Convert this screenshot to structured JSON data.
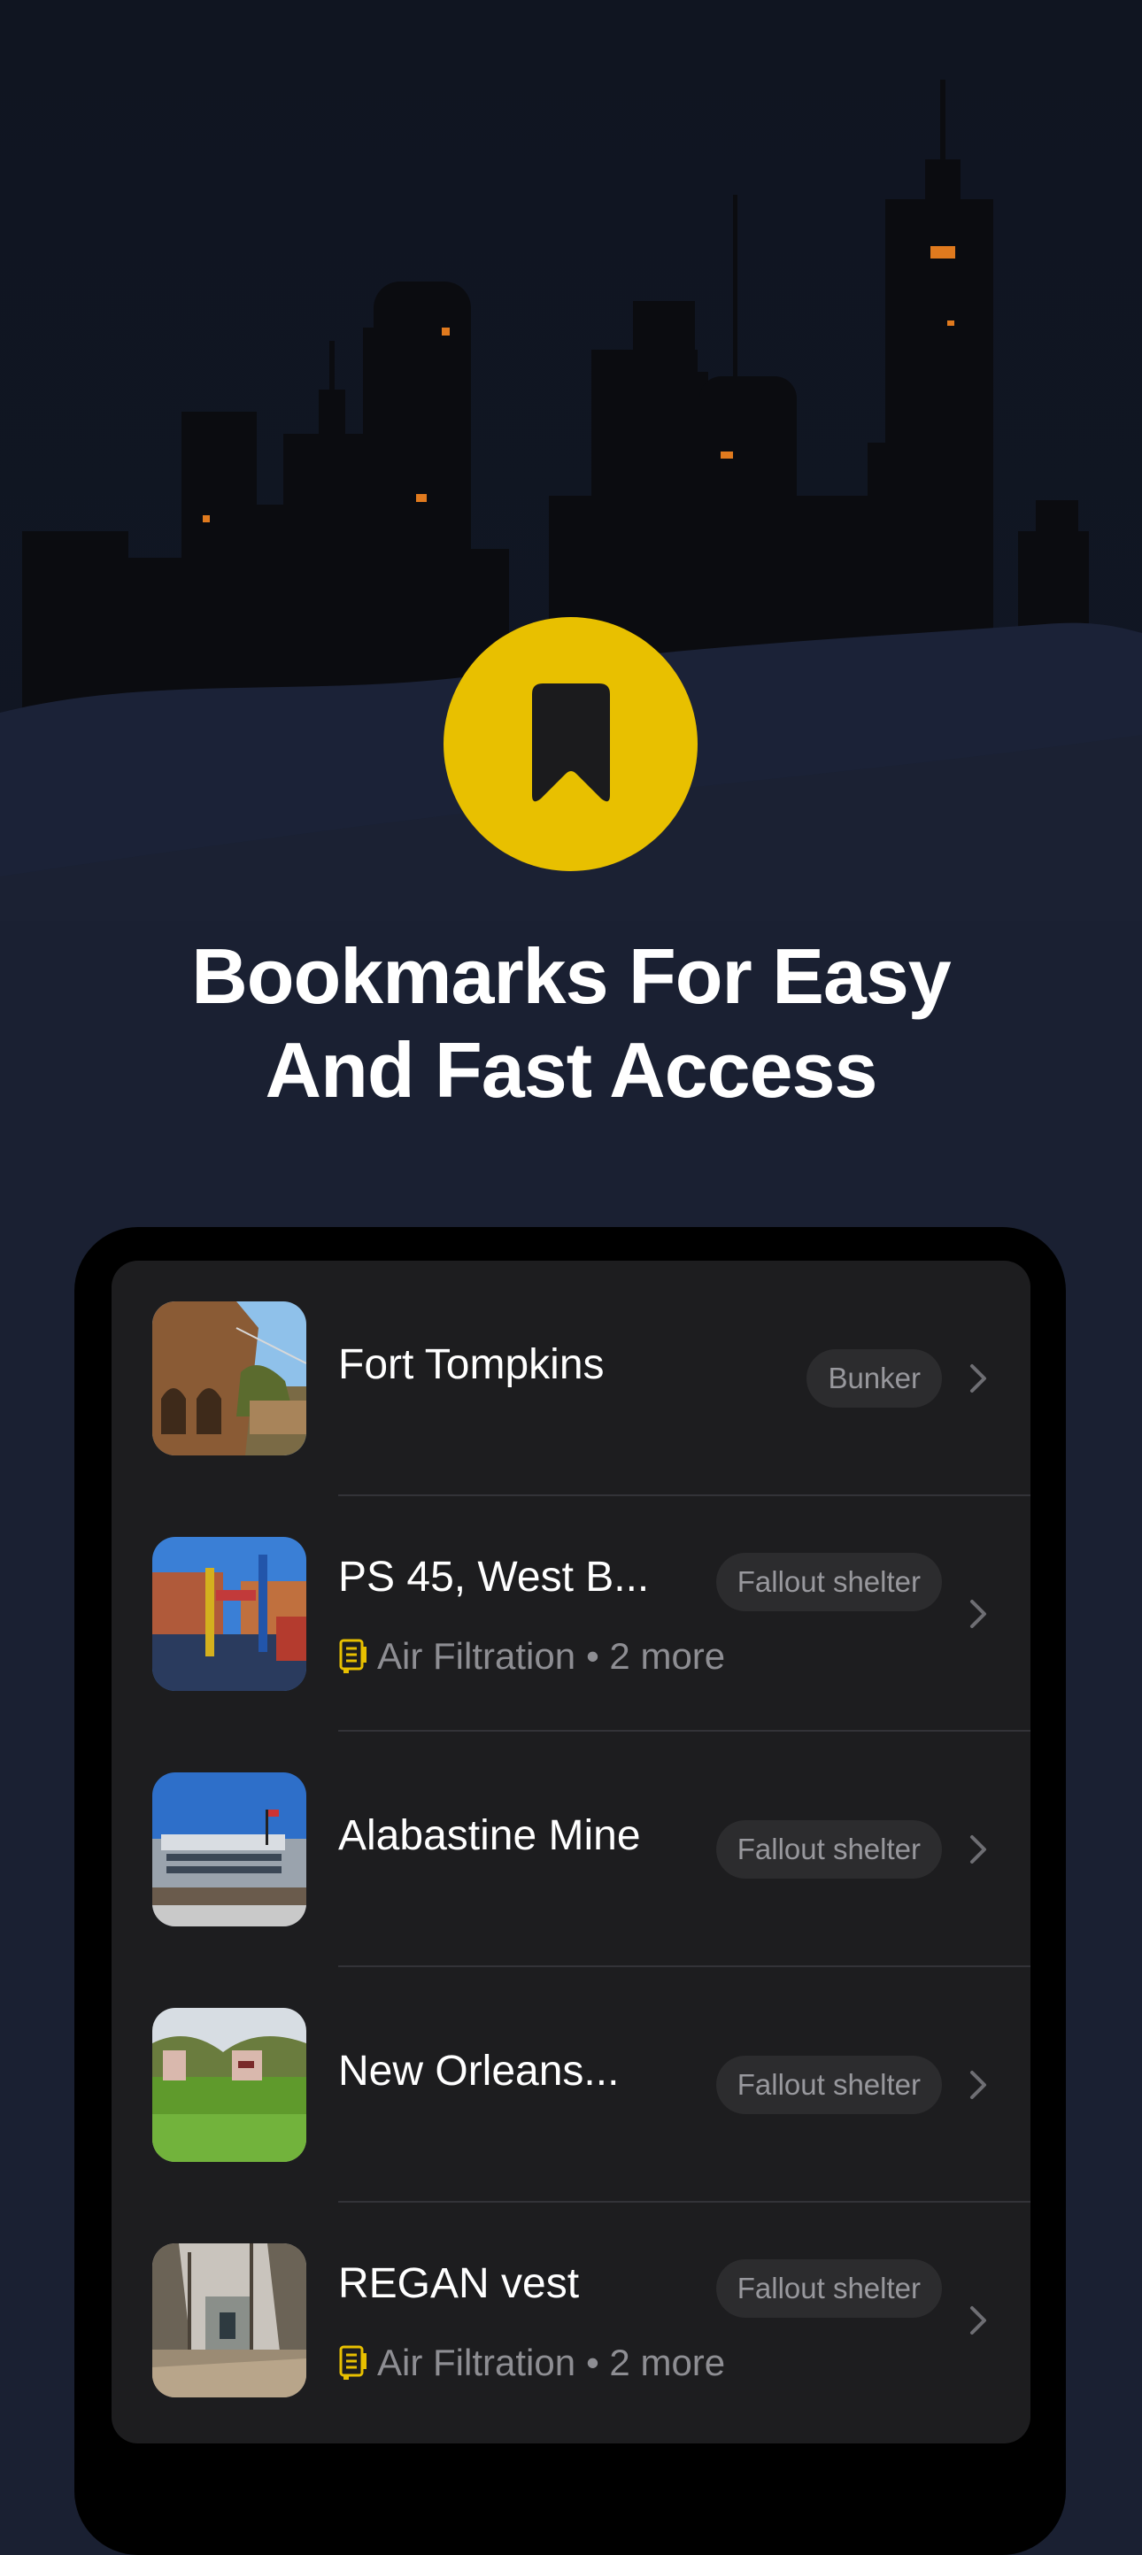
{
  "headline": {
    "line1": "Bookmarks For Easy",
    "line2": "And Fast Access"
  },
  "colors": {
    "accent": "#e8c000",
    "background": "#1a2032",
    "card": "#1d1d1f",
    "chip_bg": "#2c2c2e",
    "window_light": "#e07a1e"
  },
  "badge_icon": "bookmark-icon",
  "bookmarks": [
    {
      "title": "Fort Tompkins",
      "chip": "Bunker",
      "features": "",
      "more": "",
      "thumb": "fort-photo"
    },
    {
      "title": "PS 45, West B...",
      "chip": "Fallout shelter",
      "features": "Air Filtration",
      "more": "• 2 more",
      "thumb": "playground-photo"
    },
    {
      "title": "Alabastine Mine",
      "chip": "Fallout shelter",
      "features": "",
      "more": "",
      "thumb": "building-photo"
    },
    {
      "title": "New Orleans...",
      "chip": "Fallout shelter",
      "features": "",
      "more": "",
      "thumb": "field-photo"
    },
    {
      "title": "REGAN vest",
      "chip": "Fallout shelter",
      "features": "Air Filtration",
      "more": "• 2 more",
      "thumb": "forest-bunker-photo"
    }
  ]
}
